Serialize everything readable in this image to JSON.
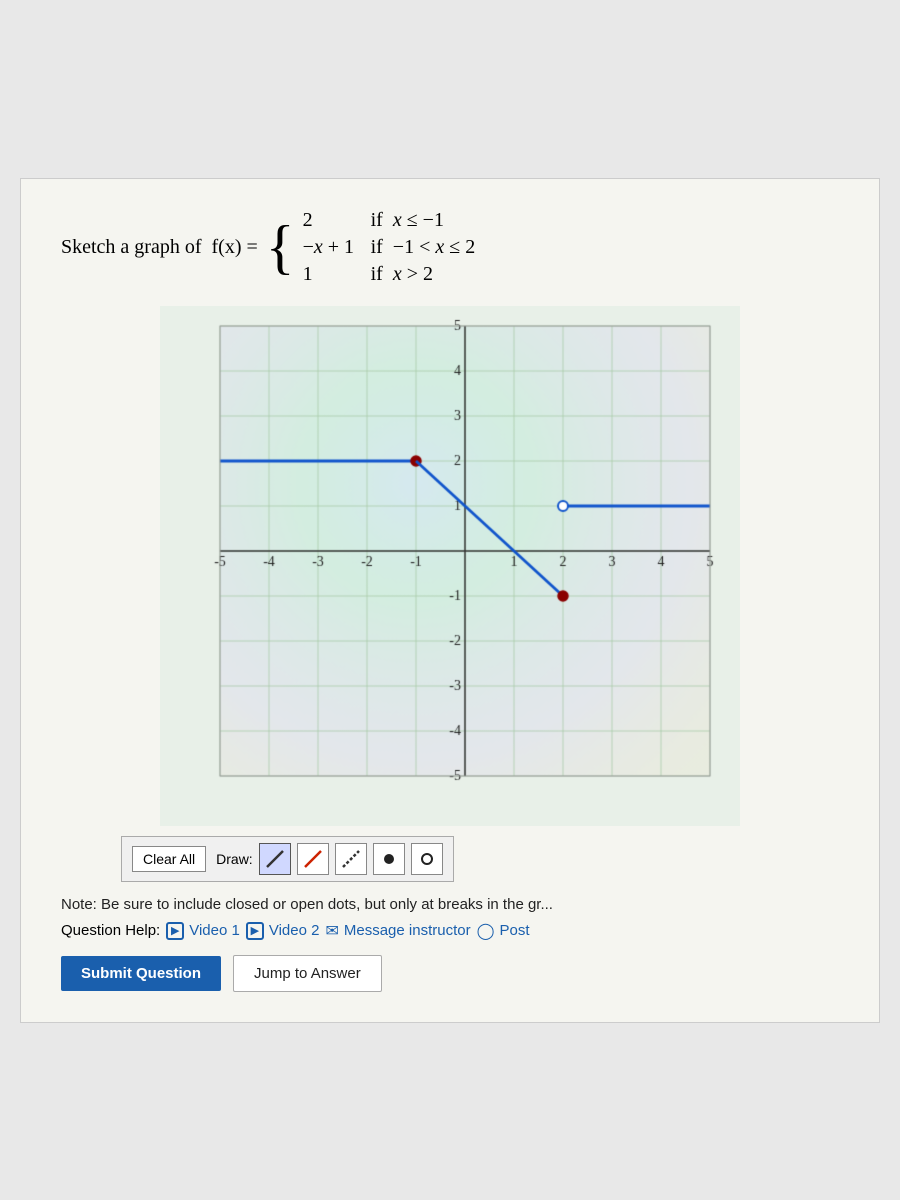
{
  "problem": {
    "sketch_text": "Sketch a graph of",
    "function_name": "f(x) =",
    "cases": [
      {
        "value": "2",
        "condition": "if  x ≤ −1"
      },
      {
        "value": "−x + 1",
        "condition": "if  −1 < x ≤ 2"
      },
      {
        "value": "1",
        "condition": "if  x > 2"
      }
    ]
  },
  "graph": {
    "x_min": -5,
    "x_max": 5,
    "y_min": -5,
    "y_max": 5,
    "x_labels": [
      "-5",
      "-4",
      "-3",
      "-2",
      "-1",
      "1",
      "2",
      "3",
      "4",
      "5"
    ],
    "y_labels": [
      "-5",
      "-4",
      "-3",
      "-2",
      "-1",
      "1",
      "2",
      "3",
      "4",
      "5"
    ]
  },
  "toolbar": {
    "clear_all_label": "Clear All",
    "draw_label": "Draw:"
  },
  "note": {
    "text": "Note: Be sure to include closed or open dots, but only at breaks in the gr..."
  },
  "question_help": {
    "label": "Question Help:",
    "video1": "Video 1",
    "video2": "Video 2",
    "message_instructor": "Message instructor",
    "post": "Post"
  },
  "buttons": {
    "submit": "Submit Question",
    "jump": "Jump to Answer"
  }
}
